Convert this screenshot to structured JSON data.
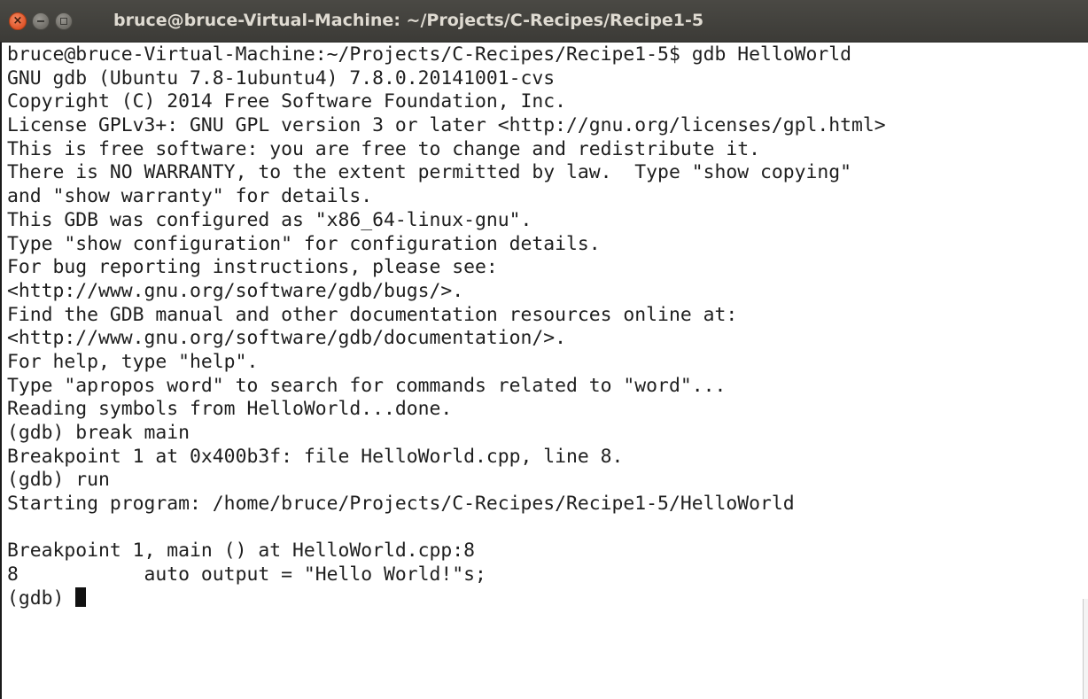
{
  "window": {
    "title": "bruce@bruce-Virtual-Machine: ~/Projects/C-Recipes/Recipe1-5",
    "close_glyph": "×"
  },
  "terminal": {
    "lines": [
      "bruce@bruce-Virtual-Machine:~/Projects/C-Recipes/Recipe1-5$ gdb HelloWorld",
      "GNU gdb (Ubuntu 7.8-1ubuntu4) 7.8.0.20141001-cvs",
      "Copyright (C) 2014 Free Software Foundation, Inc.",
      "License GPLv3+: GNU GPL version 3 or later <http://gnu.org/licenses/gpl.html>",
      "This is free software: you are free to change and redistribute it.",
      "There is NO WARRANTY, to the extent permitted by law.  Type \"show copying\"",
      "and \"show warranty\" for details.",
      "This GDB was configured as \"x86_64-linux-gnu\".",
      "Type \"show configuration\" for configuration details.",
      "For bug reporting instructions, please see:",
      "<http://www.gnu.org/software/gdb/bugs/>.",
      "Find the GDB manual and other documentation resources online at:",
      "<http://www.gnu.org/software/gdb/documentation/>.",
      "For help, type \"help\".",
      "Type \"apropos word\" to search for commands related to \"word\"...",
      "Reading symbols from HelloWorld...done.",
      "(gdb) break main",
      "Breakpoint 1 at 0x400b3f: file HelloWorld.cpp, line 8.",
      "(gdb) run",
      "Starting program: /home/bruce/Projects/C-Recipes/Recipe1-5/HelloWorld",
      "",
      "Breakpoint 1, main () at HelloWorld.cpp:8",
      "8           auto output = \"Hello World!\"s;"
    ],
    "prompt": "(gdb) "
  }
}
